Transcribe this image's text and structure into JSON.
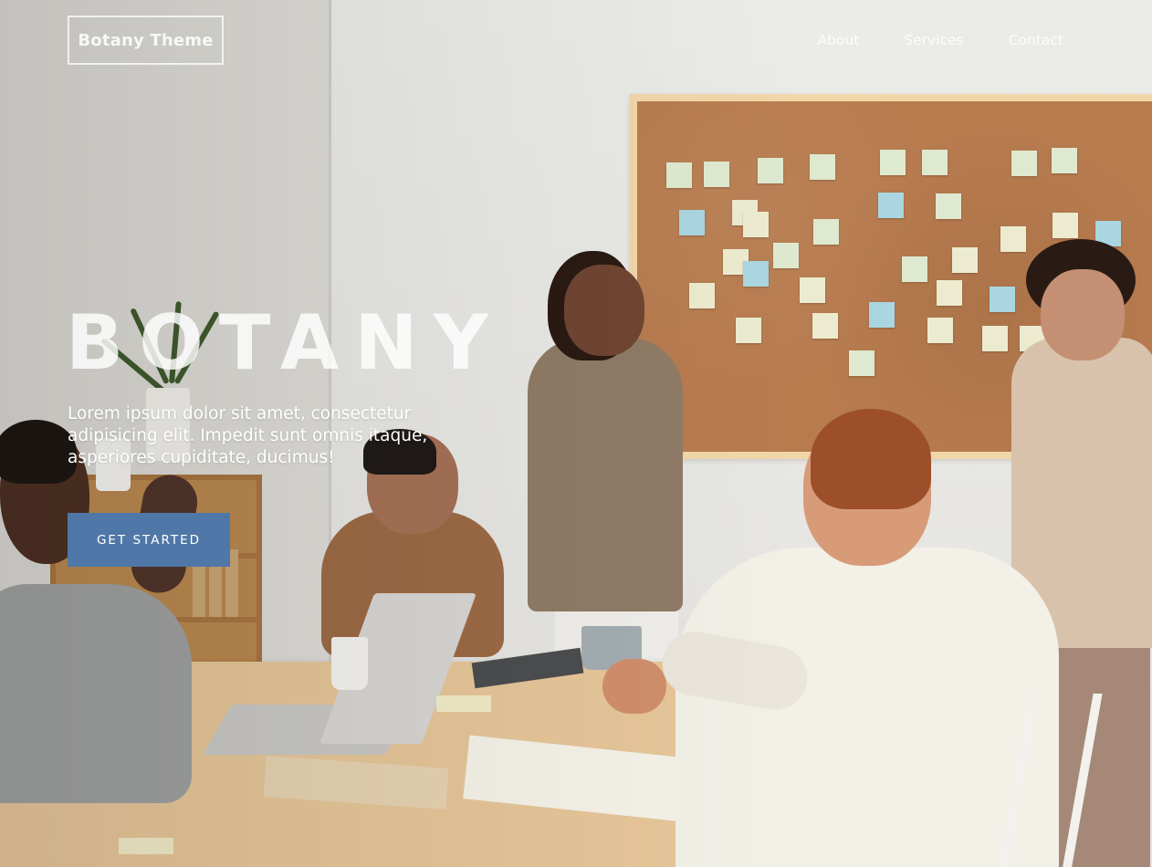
{
  "header": {
    "brand": "Botany Theme",
    "nav": [
      {
        "label": "About"
      },
      {
        "label": "Services"
      },
      {
        "label": "Contact"
      }
    ]
  },
  "hero": {
    "title": "BOTANY",
    "text": "Lorem ipsum dolor sit amet, consectetur adipisicing elit. Impedit sunt omnis itaque, asperiores cupiditate, ducimus!",
    "cta_label": "GET STARTED"
  },
  "colors": {
    "cta_background": "#4f78a8",
    "text": "#ffffff"
  }
}
